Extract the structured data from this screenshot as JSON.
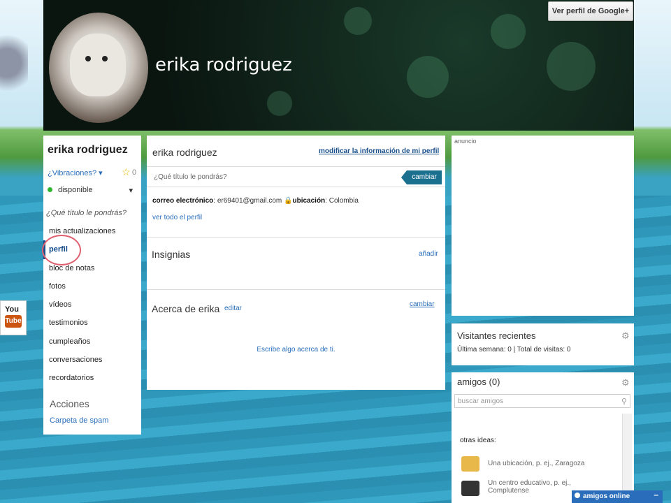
{
  "cover": {
    "name": "erika rodriguez",
    "gplus_button": "Ver perfil de Google+"
  },
  "sidebar": {
    "name": "erika rodriguez",
    "vibraciones": "¿Vibraciones?",
    "vib_count": "0",
    "status": "disponible",
    "title_question": "¿Qué título le pondrás?",
    "items": [
      {
        "label": "mis actualizaciones"
      },
      {
        "label": "perfil"
      },
      {
        "label": "bloc de notas"
      },
      {
        "label": "fotos"
      },
      {
        "label": "vídeos"
      },
      {
        "label": "testimonios"
      },
      {
        "label": "cumpleaños"
      },
      {
        "label": "conversaciones"
      },
      {
        "label": "recordatorios"
      }
    ],
    "acciones": "Acciones",
    "spam": "Carpeta de spam"
  },
  "youtube": {
    "you": "You",
    "tube": "Tube"
  },
  "main": {
    "profile_name": "erika rodriguez",
    "modify_link": "modificar la información de mi perfil",
    "title_placeholder": "¿Qué título le pondrás?",
    "cambiar_button": "cambiar",
    "email_label": "correo electrónico",
    "email_value": ": er69401@gmail.com",
    "location_label": "ubicación",
    "location_value": ": Colombia",
    "view_all": "ver todo el perfil",
    "insignias": "Insignias",
    "anadir": "añadir",
    "acerca": "Acerca de erika",
    "editar": "editar",
    "cambiar_link": "cambiar",
    "escribe": "Escribe algo acerca de ti."
  },
  "ad": {
    "label": "anuncio"
  },
  "visitors": {
    "title": "Visitantes recientes",
    "stats": "Última semana: 0 | Total de visitas: 0"
  },
  "friends": {
    "title": "amigos (0)",
    "search_placeholder": "buscar amigos",
    "otras_ideas": "otras ideas:",
    "ideas": [
      {
        "text": "Una ubicación, p. ej., Zaragoza"
      },
      {
        "text": "Un centro educativo, p. ej., Complutense"
      }
    ]
  },
  "chat": {
    "label": "amigos online",
    "min": "–"
  },
  "colors": {
    "accent": "#2a6ebb",
    "button": "#1b6f8f",
    "online_dot": "#2fb52f"
  }
}
